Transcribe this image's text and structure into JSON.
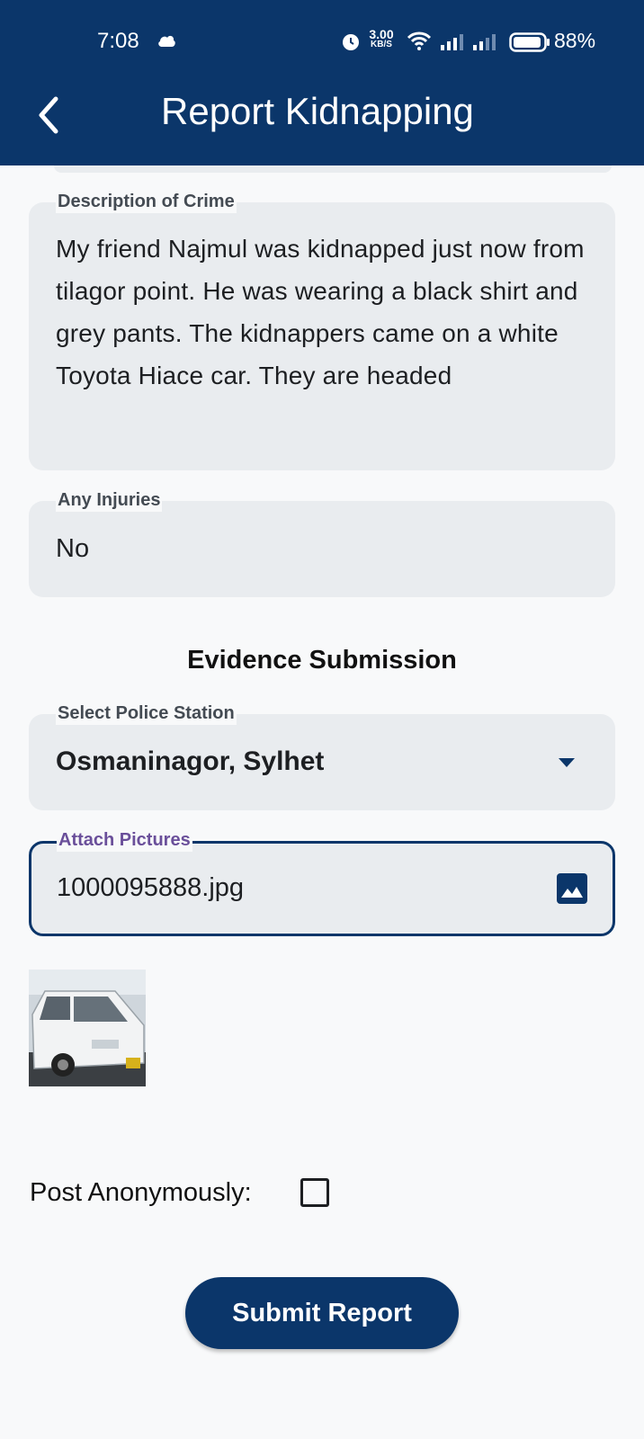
{
  "status_bar": {
    "time": "7:08",
    "speed_value": "3.00",
    "speed_unit": "KB/S",
    "battery": "88%",
    "icons": [
      "weather-icon",
      "alarm-icon",
      "wifi-icon",
      "signal-icon",
      "signal-icon",
      "battery-icon"
    ]
  },
  "app_bar": {
    "title": "Report Kidnapping",
    "back_icon": "chevron-left-icon"
  },
  "form": {
    "description": {
      "label": "Description of Crime",
      "value": "My friend Najmul was kidnapped just now from tilagor point. He was wearing a black shirt and grey pants. The kidnappers came on a white Toyota Hiace car. They are headed"
    },
    "injuries": {
      "label": "Any Injuries",
      "value": "No"
    },
    "evidence_heading": "Evidence Submission",
    "police_station": {
      "label": "Select Police Station",
      "value": "Osmaninagor, Sylhet",
      "icon": "dropdown-arrow-icon"
    },
    "attach": {
      "label": "Attach Pictures",
      "value": "1000095888.jpg",
      "icon": "image-icon"
    },
    "anonymous": {
      "label": "Post Anonymously:",
      "checked": false
    },
    "submit_label": "Submit Report"
  },
  "colors": {
    "primary": "#0b366a",
    "field_bg": "#e9ecef",
    "page_bg": "#f8f9fa",
    "focus_label": "#6a4f9a"
  }
}
